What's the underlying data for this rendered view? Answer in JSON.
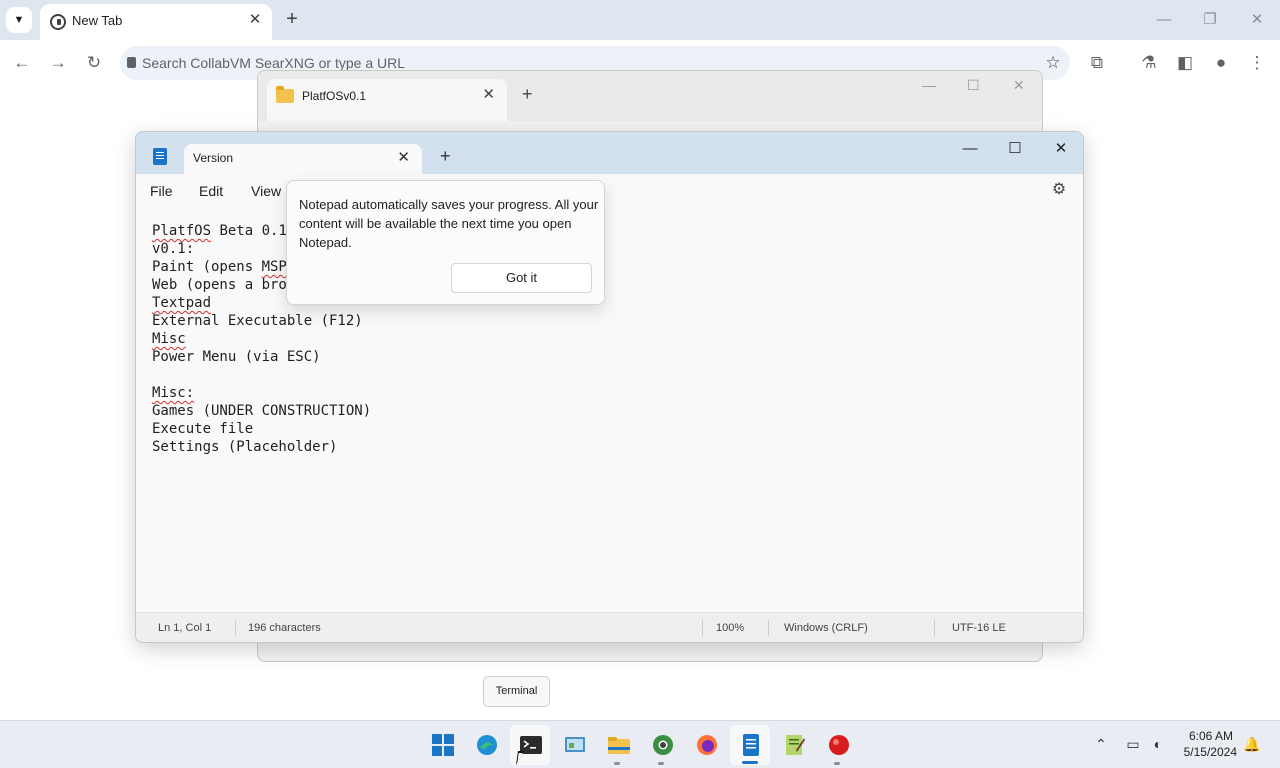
{
  "chrome": {
    "tab_title": "New Tab",
    "new_tab_symbol": "+",
    "close_symbol": "✕",
    "omnibox_placeholder": "Search CollabVM SearXNG or type a URL"
  },
  "explorer": {
    "tab_title": "PlatfOSv0.1"
  },
  "notepad": {
    "tab_title": "Version",
    "menu": {
      "file": "File",
      "edit": "Edit",
      "view": "View"
    },
    "lines": [
      "PlatfOS Beta 0.1",
      "v0.1:",
      "Paint (opens MSPa",
      "Web (opens a brow",
      "Textpad",
      "External Executable (F12)",
      "Misc",
      "Power Menu (via ESC)",
      "",
      "Misc:",
      "Games (UNDER CONSTRUCTION)",
      "Execute file",
      "Settings (Placeholder)"
    ],
    "status": {
      "position": "Ln 1, Col 1",
      "characters": "196 characters",
      "zoom": "100%",
      "line_ending": "Windows (CRLF)",
      "encoding": "UTF-16 LE"
    },
    "popup": {
      "message": "Notepad automatically saves your progress. All your content will be available the next time you open Notepad.",
      "button": "Got it"
    }
  },
  "tooltip": "Terminal",
  "taskbar": {
    "apps": [
      "start-icon",
      "edge-icon",
      "terminal-icon",
      "control-panel-icon",
      "file-explorer-icon",
      "chrome-icon",
      "firefox-icon",
      "notepad-icon",
      "notepad-plus-icon",
      "record-icon"
    ]
  },
  "clock": {
    "time": "6:06 AM",
    "date": "5/15/2024"
  },
  "colors": {
    "accent": "#1a74c8",
    "chrome_tabbar": "#dfe6ef",
    "notepad_titlebar": "#d3e0ee",
    "spellcheck": "#d03030"
  }
}
